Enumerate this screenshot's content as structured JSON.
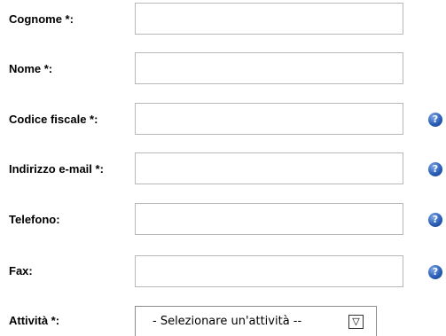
{
  "form": {
    "fields": [
      {
        "label": "Cognome *:",
        "value": ""
      },
      {
        "label": "Nome *:",
        "value": ""
      },
      {
        "label": "Codice fiscale *:",
        "value": ""
      },
      {
        "label": "Indirizzo e-mail *:",
        "value": ""
      },
      {
        "label": "Telefono:",
        "value": ""
      },
      {
        "label": "Fax:",
        "value": ""
      }
    ],
    "activity": {
      "label": "Attività *:",
      "selected": "- Selezionare un'attività --"
    },
    "help_glyph": "?",
    "arrow_glyph": "▽"
  }
}
